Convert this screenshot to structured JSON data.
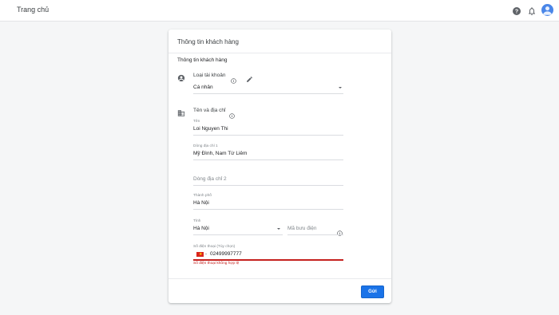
{
  "header": {
    "title": "Trang chủ"
  },
  "card": {
    "title": "Thông tin khách hàng",
    "section_title": "Thông tin khách hàng",
    "account": {
      "label": "Loại tài khoản",
      "value": "Cá nhân"
    },
    "address": {
      "label": "Tên và địa chỉ",
      "name": {
        "label": "Tên",
        "value": "Loi Nguyen Thi"
      },
      "line1": {
        "label": "Dòng địa chỉ 1",
        "value": "Mỹ Đình, Nam Từ Liêm"
      },
      "line2": {
        "placeholder": "Dòng địa chỉ 2"
      },
      "city": {
        "label": "Thành phố",
        "value": "Hà Nội"
      },
      "province": {
        "label": "Tỉnh",
        "value": "Hà Nội"
      },
      "postal": {
        "placeholder": "Mã bưu điện"
      },
      "phone": {
        "label": "Số điện thoại (Tùy chọn)",
        "value": "02499997777",
        "error": "Số điện thoại không hợp lệ"
      }
    },
    "submit_label": "Gửi"
  },
  "colors": {
    "accent": "#1a73e8",
    "error": "#c5221f",
    "avatar": "#4a86e8"
  },
  "icons": [
    "help-icon",
    "bell-icon",
    "account-circle-icon",
    "info-icon",
    "pencil-icon",
    "building-icon",
    "vietnam-flag-icon",
    "chevron-down-icon"
  ]
}
